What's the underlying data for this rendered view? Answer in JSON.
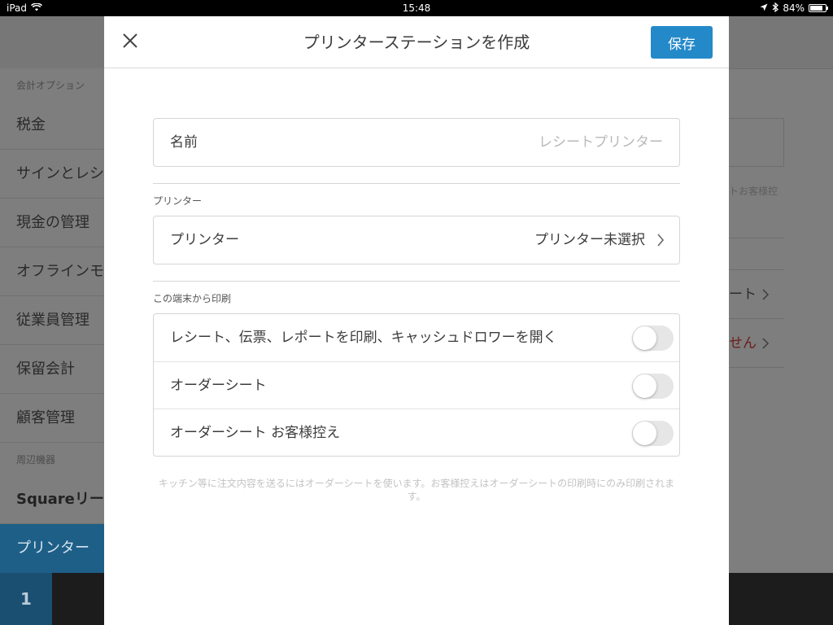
{
  "status_bar": {
    "device": "iPad",
    "time": "15:48",
    "battery": "84%",
    "battery_level": 0.84
  },
  "background": {
    "sidebar": {
      "section1": "会計オプション",
      "items": [
        "税金",
        "サインとレシ",
        "現金の管理",
        "オフラインモ",
        "従業員管理",
        "保留会計",
        "顧客管理"
      ],
      "section2": "周辺機器",
      "peripheral_items": [
        "Squareリータ",
        "プリンター"
      ],
      "bottom_number": "1"
    },
    "right_panel": {
      "hint": "トお客様控",
      "row1": "ート",
      "row2": "せん"
    }
  },
  "modal": {
    "title": "プリンターステーションを作成",
    "save_label": "保存",
    "name_label": "名前",
    "name_placeholder": "レシートプリンター",
    "printer_section": "プリンター",
    "printer_label": "プリンター",
    "printer_value": "プリンター未選択",
    "print_section": "この端末から印刷",
    "toggles": [
      {
        "label": "レシート、伝票、レポートを印刷、キャッシュドロワーを開く",
        "on": false
      },
      {
        "label": "オーダーシート",
        "on": false
      },
      {
        "label": "オーダーシート お客様控え",
        "on": false
      }
    ],
    "footnote": "キッチン等に注文内容を送るにはオーダーシートを使います。お客様控えはオーダーシートの印刷時にのみ印刷されます。"
  },
  "colors": {
    "accent": "#2489c9",
    "toggle_off": "#e6e6e6",
    "overlay": "#7f7f7f"
  },
  "icons": {
    "close": "close-icon",
    "chevron": "chevron-right-icon",
    "wifi": "wifi-icon",
    "location": "location-icon",
    "bluetooth": "bluetooth-icon",
    "battery": "battery-icon"
  }
}
